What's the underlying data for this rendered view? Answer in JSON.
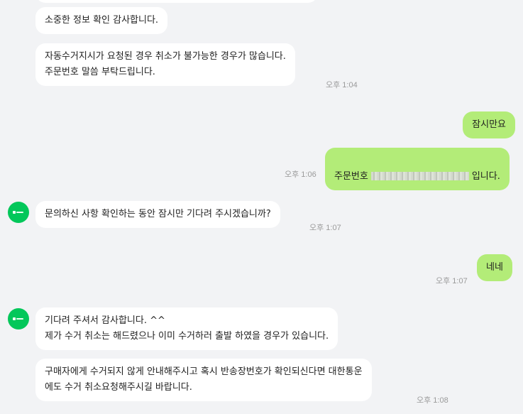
{
  "messages": [
    {
      "text": "소중한 정보 확인 감사합니다."
    },
    {
      "text": "자동수거지시가 요청된 경우 취소가 불가능한 경우가 많습니다.\n주문번호 말씀 부탁드립니다.",
      "time": "오후 1:04"
    },
    {
      "text": "잠시만요"
    },
    {
      "prefix": "주문번호",
      "suffix": "입니다.",
      "time": "오후 1:06"
    },
    {
      "text": "문의하신 사항 확인하는 동안 잠시만 기다려 주시겠습니까?",
      "time": "오후 1:07"
    },
    {
      "text": "네네",
      "time": "오후 1:07"
    },
    {
      "text": "기다려 주셔서 감사합니다. ^^\n제가 수거 취소는 해드렸으나 이미 수거하러 출발 하였을 경우가 있습니다."
    },
    {
      "text": "구매자에게 수거되지 않게 안내해주시고 혹시 반송장번호가 확인되신다면 대한통운\n에도 수거 취소요청해주시길 바랍니다.",
      "time": "오후 1:08"
    }
  ],
  "colors": {
    "outgoing": "#b3ec78",
    "incoming": "#ffffff",
    "background": "#f2f3f5",
    "avatar": "#03c75a"
  },
  "icons": {
    "avatar": "smartstore-logo-icon"
  }
}
